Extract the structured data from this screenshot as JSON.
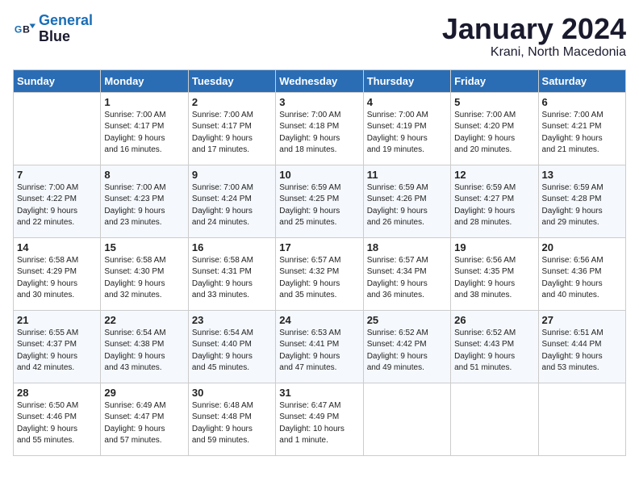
{
  "header": {
    "logo_line1": "General",
    "logo_line2": "Blue",
    "month": "January 2024",
    "location": "Krani, North Macedonia"
  },
  "weekdays": [
    "Sunday",
    "Monday",
    "Tuesday",
    "Wednesday",
    "Thursday",
    "Friday",
    "Saturday"
  ],
  "weeks": [
    [
      {
        "day": "",
        "info": ""
      },
      {
        "day": "1",
        "info": "Sunrise: 7:00 AM\nSunset: 4:17 PM\nDaylight: 9 hours\nand 16 minutes."
      },
      {
        "day": "2",
        "info": "Sunrise: 7:00 AM\nSunset: 4:17 PM\nDaylight: 9 hours\nand 17 minutes."
      },
      {
        "day": "3",
        "info": "Sunrise: 7:00 AM\nSunset: 4:18 PM\nDaylight: 9 hours\nand 18 minutes."
      },
      {
        "day": "4",
        "info": "Sunrise: 7:00 AM\nSunset: 4:19 PM\nDaylight: 9 hours\nand 19 minutes."
      },
      {
        "day": "5",
        "info": "Sunrise: 7:00 AM\nSunset: 4:20 PM\nDaylight: 9 hours\nand 20 minutes."
      },
      {
        "day": "6",
        "info": "Sunrise: 7:00 AM\nSunset: 4:21 PM\nDaylight: 9 hours\nand 21 minutes."
      }
    ],
    [
      {
        "day": "7",
        "info": "Sunrise: 7:00 AM\nSunset: 4:22 PM\nDaylight: 9 hours\nand 22 minutes."
      },
      {
        "day": "8",
        "info": "Sunrise: 7:00 AM\nSunset: 4:23 PM\nDaylight: 9 hours\nand 23 minutes."
      },
      {
        "day": "9",
        "info": "Sunrise: 7:00 AM\nSunset: 4:24 PM\nDaylight: 9 hours\nand 24 minutes."
      },
      {
        "day": "10",
        "info": "Sunrise: 6:59 AM\nSunset: 4:25 PM\nDaylight: 9 hours\nand 25 minutes."
      },
      {
        "day": "11",
        "info": "Sunrise: 6:59 AM\nSunset: 4:26 PM\nDaylight: 9 hours\nand 26 minutes."
      },
      {
        "day": "12",
        "info": "Sunrise: 6:59 AM\nSunset: 4:27 PM\nDaylight: 9 hours\nand 28 minutes."
      },
      {
        "day": "13",
        "info": "Sunrise: 6:59 AM\nSunset: 4:28 PM\nDaylight: 9 hours\nand 29 minutes."
      }
    ],
    [
      {
        "day": "14",
        "info": "Sunrise: 6:58 AM\nSunset: 4:29 PM\nDaylight: 9 hours\nand 30 minutes."
      },
      {
        "day": "15",
        "info": "Sunrise: 6:58 AM\nSunset: 4:30 PM\nDaylight: 9 hours\nand 32 minutes."
      },
      {
        "day": "16",
        "info": "Sunrise: 6:58 AM\nSunset: 4:31 PM\nDaylight: 9 hours\nand 33 minutes."
      },
      {
        "day": "17",
        "info": "Sunrise: 6:57 AM\nSunset: 4:32 PM\nDaylight: 9 hours\nand 35 minutes."
      },
      {
        "day": "18",
        "info": "Sunrise: 6:57 AM\nSunset: 4:34 PM\nDaylight: 9 hours\nand 36 minutes."
      },
      {
        "day": "19",
        "info": "Sunrise: 6:56 AM\nSunset: 4:35 PM\nDaylight: 9 hours\nand 38 minutes."
      },
      {
        "day": "20",
        "info": "Sunrise: 6:56 AM\nSunset: 4:36 PM\nDaylight: 9 hours\nand 40 minutes."
      }
    ],
    [
      {
        "day": "21",
        "info": "Sunrise: 6:55 AM\nSunset: 4:37 PM\nDaylight: 9 hours\nand 42 minutes."
      },
      {
        "day": "22",
        "info": "Sunrise: 6:54 AM\nSunset: 4:38 PM\nDaylight: 9 hours\nand 43 minutes."
      },
      {
        "day": "23",
        "info": "Sunrise: 6:54 AM\nSunset: 4:40 PM\nDaylight: 9 hours\nand 45 minutes."
      },
      {
        "day": "24",
        "info": "Sunrise: 6:53 AM\nSunset: 4:41 PM\nDaylight: 9 hours\nand 47 minutes."
      },
      {
        "day": "25",
        "info": "Sunrise: 6:52 AM\nSunset: 4:42 PM\nDaylight: 9 hours\nand 49 minutes."
      },
      {
        "day": "26",
        "info": "Sunrise: 6:52 AM\nSunset: 4:43 PM\nDaylight: 9 hours\nand 51 minutes."
      },
      {
        "day": "27",
        "info": "Sunrise: 6:51 AM\nSunset: 4:44 PM\nDaylight: 9 hours\nand 53 minutes."
      }
    ],
    [
      {
        "day": "28",
        "info": "Sunrise: 6:50 AM\nSunset: 4:46 PM\nDaylight: 9 hours\nand 55 minutes."
      },
      {
        "day": "29",
        "info": "Sunrise: 6:49 AM\nSunset: 4:47 PM\nDaylight: 9 hours\nand 57 minutes."
      },
      {
        "day": "30",
        "info": "Sunrise: 6:48 AM\nSunset: 4:48 PM\nDaylight: 9 hours\nand 59 minutes."
      },
      {
        "day": "31",
        "info": "Sunrise: 6:47 AM\nSunset: 4:49 PM\nDaylight: 10 hours\nand 1 minute."
      },
      {
        "day": "",
        "info": ""
      },
      {
        "day": "",
        "info": ""
      },
      {
        "day": "",
        "info": ""
      }
    ]
  ]
}
